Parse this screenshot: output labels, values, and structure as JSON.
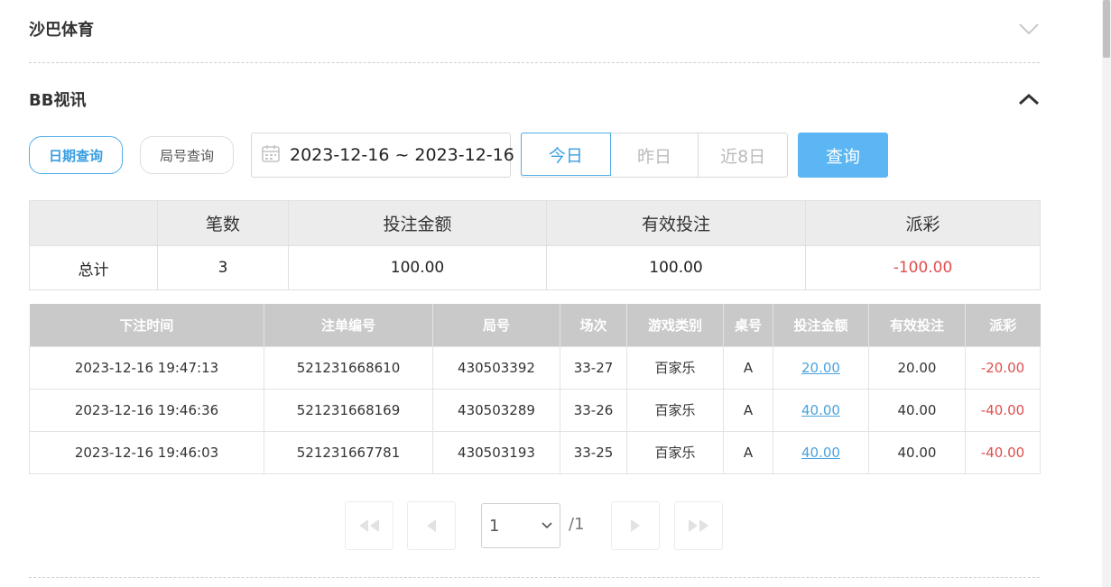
{
  "sections": {
    "shaba": {
      "title": "沙巴体育",
      "expanded": false
    },
    "bb": {
      "title": "BB视讯",
      "expanded": true
    }
  },
  "query_modes": {
    "date": "日期查询",
    "round": "局号查询",
    "active": "date"
  },
  "date_range": {
    "value": "2023-12-16 ~ 2023-12-16",
    "icon": "calendar-icon"
  },
  "quick_ranges": [
    {
      "label": "今日",
      "active": true
    },
    {
      "label": "昨日",
      "active": false
    },
    {
      "label": "近8日",
      "active": false
    }
  ],
  "query_button": "查询",
  "summary": {
    "headers": [
      "",
      "笔数",
      "投注金额",
      "有效投注",
      "派彩"
    ],
    "row": {
      "label": "总计",
      "count": "3",
      "bet": "100.00",
      "valid": "100.00",
      "payout": "-100.00"
    }
  },
  "detail": {
    "headers": [
      "下注时间",
      "注单编号",
      "局号",
      "场次",
      "游戏类别",
      "桌号",
      "投注金额",
      "有效投注",
      "派彩"
    ],
    "rows": [
      {
        "time": "2023-12-16 19:47:13",
        "order": "521231668610",
        "round": "430503392",
        "session": "33-27",
        "game": "百家乐",
        "table": "A",
        "bet": "20.00",
        "valid": "20.00",
        "payout": "-20.00"
      },
      {
        "time": "2023-12-16 19:46:36",
        "order": "521231668169",
        "round": "430503289",
        "session": "33-26",
        "game": "百家乐",
        "table": "A",
        "bet": "40.00",
        "valid": "40.00",
        "payout": "-40.00"
      },
      {
        "time": "2023-12-16 19:46:03",
        "order": "521231667781",
        "round": "430503193",
        "session": "33-25",
        "game": "百家乐",
        "table": "A",
        "bet": "40.00",
        "valid": "40.00",
        "payout": "-40.00"
      }
    ]
  },
  "pagination": {
    "current": "1",
    "total": "/1"
  },
  "colors": {
    "accent": "#5bb6f3",
    "negative": "#e04f4f",
    "link": "#4aa3df",
    "header_gray": "#c9c9c9"
  }
}
